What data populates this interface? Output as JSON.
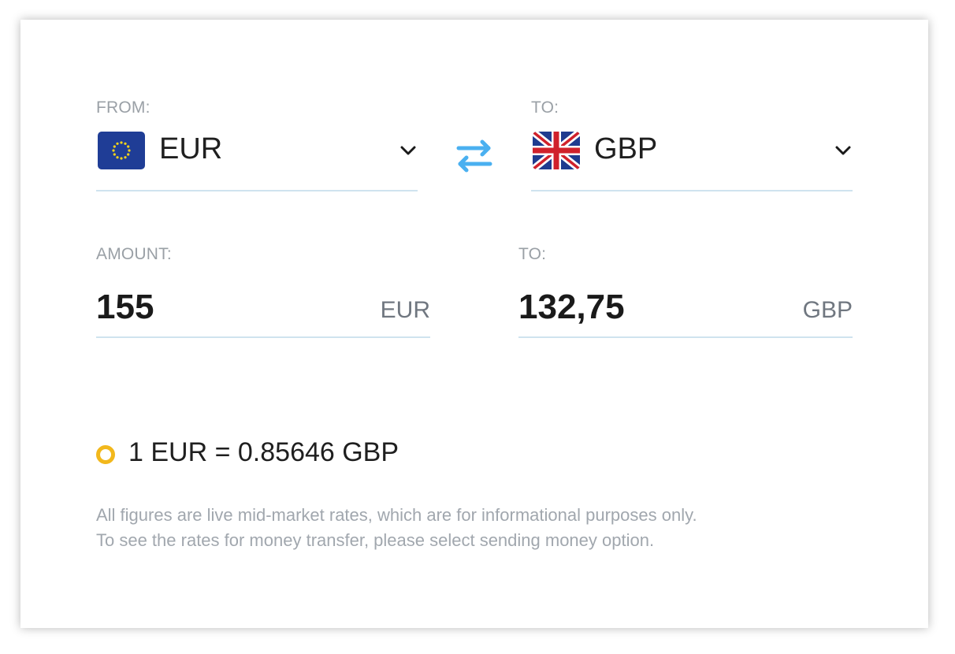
{
  "from": {
    "label": "FROM:",
    "currency": "EUR",
    "flag_icon": "eu-flag-icon"
  },
  "to": {
    "label": "TO:",
    "currency": "GBP",
    "flag_icon": "uk-flag-icon"
  },
  "swap_icon": "swap-arrows-icon",
  "amount": {
    "label": "AMOUNT:",
    "value": "155",
    "unit": "EUR"
  },
  "result": {
    "label": "TO:",
    "value": "132,75",
    "unit": "GBP"
  },
  "rate": {
    "text": "1 EUR = 0.85646 GBP",
    "indicator_color": "#f2b81c"
  },
  "note": {
    "line1": "All figures are live mid-market rates, which are for informational purposes only.",
    "line2": "To see the rates for money transfer, please select sending money option."
  },
  "colors": {
    "accent": "#4ab0f0",
    "underline": "#cfe3ef",
    "muted_text": "#9aa0a6"
  }
}
